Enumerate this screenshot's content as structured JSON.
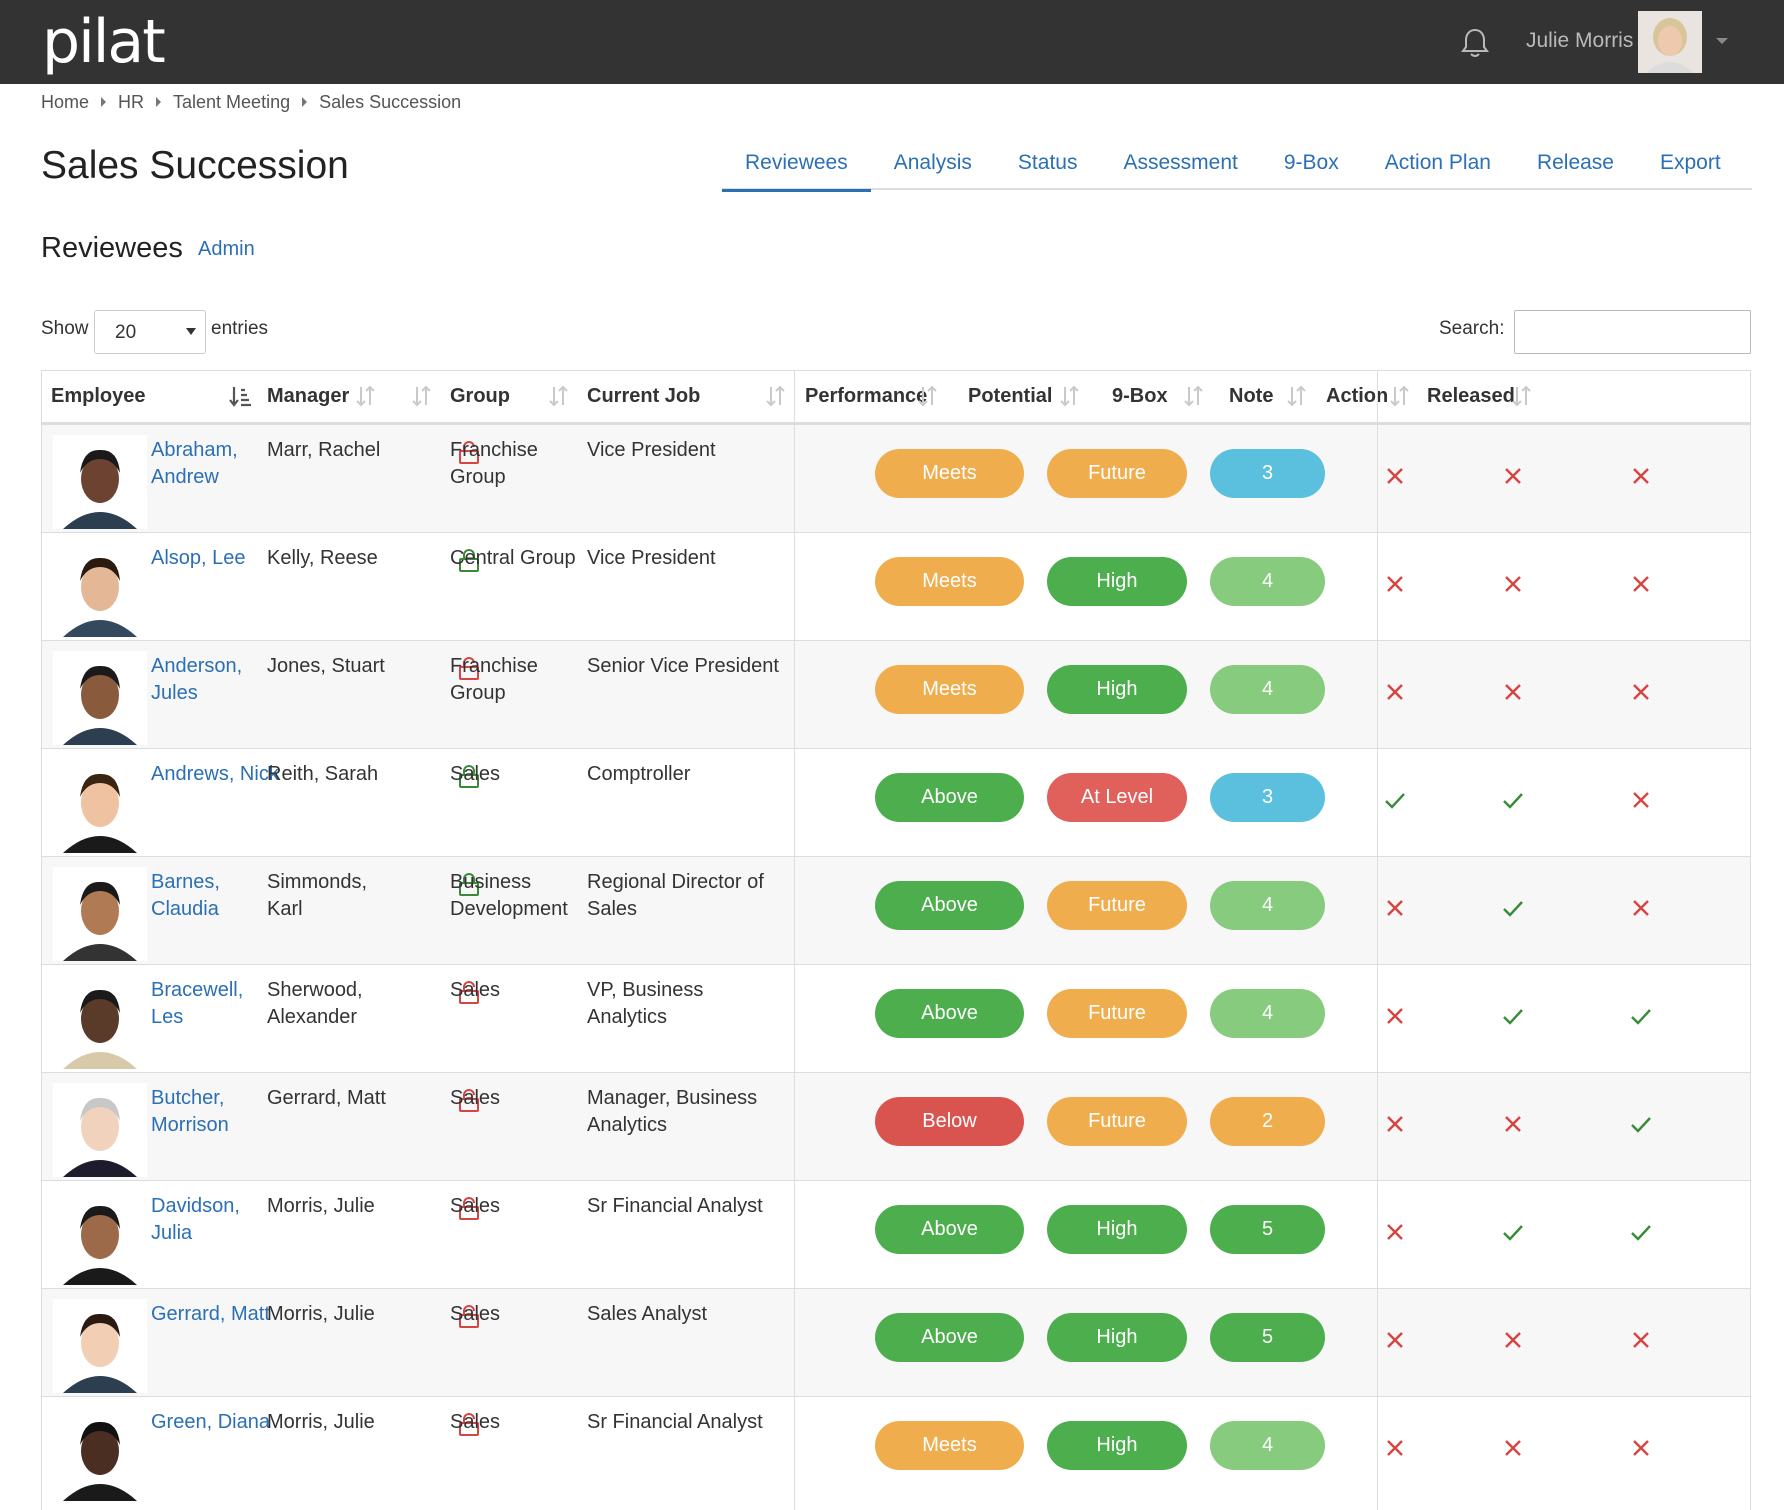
{
  "app": {
    "logo": "pilat"
  },
  "user": {
    "name": "Julie Morris"
  },
  "breadcrumb": [
    "Home",
    "HR",
    "Talent Meeting",
    "Sales Succession"
  ],
  "page": {
    "title": "Sales Succession",
    "section": "Reviewees",
    "admin_link": "Admin"
  },
  "tabs": [
    "Reviewees",
    "Analysis",
    "Status",
    "Assessment",
    "9-Box",
    "Action Plan",
    "Release",
    "Export"
  ],
  "active_tab": "Reviewees",
  "controls": {
    "show_label": "Show",
    "entries_value": "20",
    "entries_label": "entries",
    "search_label": "Search:",
    "search_value": ""
  },
  "columns": [
    "Employee",
    "Manager",
    "",
    "Group",
    "Current Job",
    "Performance",
    "Potential",
    "9-Box",
    "Note",
    "Action",
    "Released"
  ],
  "colors": {
    "orange": "#f0ad4e",
    "green": "#4cae4c",
    "light_green": "#86cb7e",
    "blue": "#5bc0de",
    "red": "#e0605c",
    "dark_red": "#d9534f",
    "link": "#2b6fb5",
    "x_mark": "#d64541",
    "check_mark": "#3a8a3a",
    "lock_open": "#3a8a3a",
    "lock_closed": "#d64541"
  },
  "rows": [
    {
      "employee": "Abraham, Andrew",
      "manager": "Marr, Rachel",
      "lock": "red",
      "group": "Franchise Group",
      "job": "Vice President",
      "performance": "Meets",
      "perf_color": "orange",
      "potential": "Future",
      "pot_color": "orange",
      "ninebox": "3",
      "box_color": "blue",
      "note": "x",
      "action": "x",
      "released": "x"
    },
    {
      "employee": "Alsop, Lee",
      "manager": "Kelly, Reese",
      "lock": "green",
      "group": "Central Group",
      "job": "Vice President",
      "performance": "Meets",
      "perf_color": "orange",
      "potential": "High",
      "pot_color": "green",
      "ninebox": "4",
      "box_color": "light_green",
      "note": "x",
      "action": "x",
      "released": "x"
    },
    {
      "employee": "Anderson, Jules",
      "manager": "Jones, Stuart",
      "lock": "red",
      "group": "Franchise Group",
      "job": "Senior Vice President",
      "performance": "Meets",
      "perf_color": "orange",
      "potential": "High",
      "pot_color": "green",
      "ninebox": "4",
      "box_color": "light_green",
      "note": "x",
      "action": "x",
      "released": "x"
    },
    {
      "employee": "Andrews, Nick",
      "manager": "Reith, Sarah",
      "lock": "green",
      "group": "Sales",
      "job": "Comptroller",
      "performance": "Above",
      "perf_color": "green",
      "potential": "At Level",
      "pot_color": "red",
      "ninebox": "3",
      "box_color": "blue",
      "note": "check",
      "action": "check",
      "released": "x"
    },
    {
      "employee": "Barnes, Claudia",
      "manager": "Simmonds, Karl",
      "lock": "green",
      "group": "Business Development",
      "job": "Regional Director of Sales",
      "performance": "Above",
      "perf_color": "green",
      "potential": "Future",
      "pot_color": "orange",
      "ninebox": "4",
      "box_color": "light_green",
      "note": "x",
      "action": "check",
      "released": "x"
    },
    {
      "employee": "Bracewell, Les",
      "manager": "Sherwood, Alexander",
      "lock": "red",
      "group": "Sales",
      "job": "VP, Business Analytics",
      "performance": "Above",
      "perf_color": "green",
      "potential": "Future",
      "pot_color": "orange",
      "ninebox": "4",
      "box_color": "light_green",
      "note": "x",
      "action": "check",
      "released": "check"
    },
    {
      "employee": "Butcher, Morrison",
      "manager": "Gerrard, Matt",
      "lock": "red",
      "group": "Sales",
      "job": "Manager, Business Analytics",
      "performance": "Below",
      "perf_color": "dark_red",
      "potential": "Future",
      "pot_color": "orange",
      "ninebox": "2",
      "box_color": "orange",
      "note": "x",
      "action": "x",
      "released": "check"
    },
    {
      "employee": "Davidson, Julia",
      "manager": "Morris, Julie",
      "lock": "red",
      "group": "Sales",
      "job": "Sr Financial Analyst",
      "performance": "Above",
      "perf_color": "green",
      "potential": "High",
      "pot_color": "green",
      "ninebox": "5",
      "box_color": "green",
      "note": "x",
      "action": "check",
      "released": "check"
    },
    {
      "employee": "Gerrard, Matt",
      "manager": "Morris, Julie",
      "lock": "red",
      "group": "Sales",
      "job": "Sales Analyst",
      "performance": "Above",
      "perf_color": "green",
      "potential": "High",
      "pot_color": "green",
      "ninebox": "5",
      "box_color": "green",
      "note": "x",
      "action": "x",
      "released": "x"
    },
    {
      "employee": "Green, Diana",
      "manager": "Morris, Julie",
      "lock": "red",
      "group": "Sales",
      "job": "Sr Financial Analyst",
      "performance": "Meets",
      "perf_color": "orange",
      "potential": "High",
      "pot_color": "green",
      "ninebox": "4",
      "box_color": "light_green",
      "note": "x",
      "action": "x",
      "released": "x"
    }
  ]
}
